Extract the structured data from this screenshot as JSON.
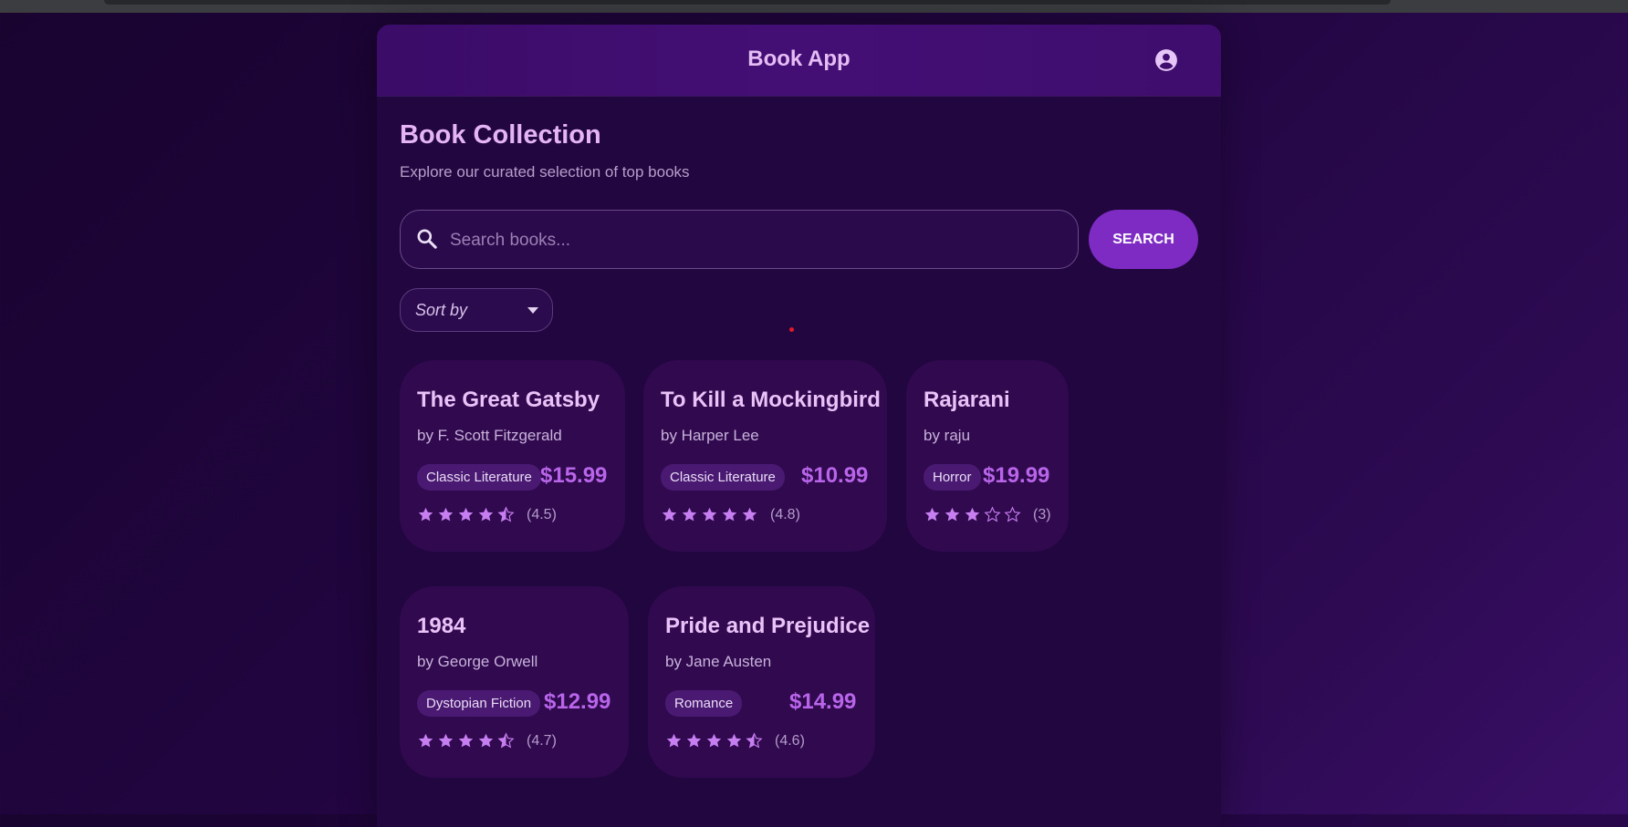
{
  "colors": {
    "accent": "#7e2bc4",
    "price": "#b865ea",
    "star": "#c77ef0",
    "title": "#e4b4f5"
  },
  "header": {
    "title": "Book App",
    "account_icon": "account-circle-icon"
  },
  "page": {
    "title": "Book Collection",
    "subtitle": "Explore our curated selection of top books"
  },
  "search": {
    "placeholder": "Search books...",
    "value": "",
    "button_label": "SEARCH",
    "icon": "search-icon"
  },
  "sort": {
    "label": "Sort by"
  },
  "books": [
    {
      "title": "The Great Gatsby",
      "author": "by F. Scott Fitzgerald",
      "genre": "Classic Literature",
      "price": "$15.99",
      "rating": 4.5,
      "rating_label": "(4.5)"
    },
    {
      "title": "To Kill a Mockingbird",
      "author": "by Harper Lee",
      "genre": "Classic Literature",
      "price": "$10.99",
      "rating": 4.8,
      "rating_label": "(4.8)"
    },
    {
      "title": "Rajarani",
      "author": "by raju",
      "genre": "Horror",
      "price": "$19.99",
      "rating": 3,
      "rating_label": "(3)"
    },
    {
      "title": "1984",
      "author": "by George Orwell",
      "genre": "Dystopian Fiction",
      "price": "$12.99",
      "rating": 4.7,
      "rating_label": "(4.7)"
    },
    {
      "title": "Pride and Prejudice",
      "author": "by Jane Austen",
      "genre": "Romance",
      "price": "$14.99",
      "rating": 4.6,
      "rating_label": "(4.6)"
    }
  ]
}
